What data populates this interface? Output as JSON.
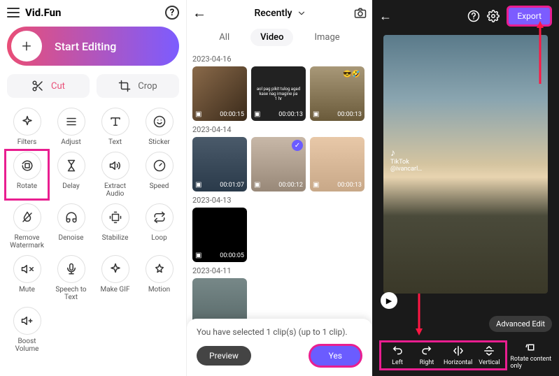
{
  "panel1": {
    "app_name": "Vid.Fun",
    "start_editing": "Start Editing",
    "cut": "Cut",
    "crop": "Crop",
    "tools": [
      {
        "label": "Filters"
      },
      {
        "label": "Adjust"
      },
      {
        "label": "Text"
      },
      {
        "label": "Sticker"
      },
      {
        "label": "Rotate"
      },
      {
        "label": "Delay"
      },
      {
        "label": "Extract\nAudio"
      },
      {
        "label": "Speed"
      },
      {
        "label": "Remove\nWatermark"
      },
      {
        "label": "Denoise"
      },
      {
        "label": "Stabilize"
      },
      {
        "label": "Loop"
      },
      {
        "label": "Mute"
      },
      {
        "label": "Speech to\nText"
      },
      {
        "label": "Make GIF"
      },
      {
        "label": "Motion"
      },
      {
        "label": "Boost\nVolume"
      }
    ]
  },
  "panel2": {
    "recently": "Recently",
    "tabs": {
      "all": "All",
      "video": "Video",
      "image": "Image"
    },
    "groups": [
      {
        "date": "2023-04-16",
        "items": [
          {
            "dur": "00:00:15"
          },
          {
            "dur": "00:00:13"
          },
          {
            "dur": "00:00:13"
          }
        ]
      },
      {
        "date": "2023-04-14",
        "items": [
          {
            "dur": "00:01:07"
          },
          {
            "dur": "00:00:12",
            "checked": true
          },
          {
            "dur": "00:00:13"
          }
        ]
      },
      {
        "date": "2023-04-13",
        "items": [
          {
            "dur": "00:00:05"
          }
        ]
      },
      {
        "date": "2023-04-11",
        "items": [
          {
            "dur": ""
          }
        ]
      }
    ],
    "sheet": {
      "text": "You have selected 1 clip(s) (up to 1 clip).",
      "preview": "Preview",
      "yes": "Yes"
    }
  },
  "panel3": {
    "export": "Export",
    "tiktok_user": "@ivancarl…",
    "advanced_edit": "Advanced Edit",
    "tools": [
      {
        "label": "Left"
      },
      {
        "label": "Right"
      },
      {
        "label": "Horizontal"
      },
      {
        "label": "Vertical"
      }
    ],
    "rotate_only": "Rotate content only"
  }
}
